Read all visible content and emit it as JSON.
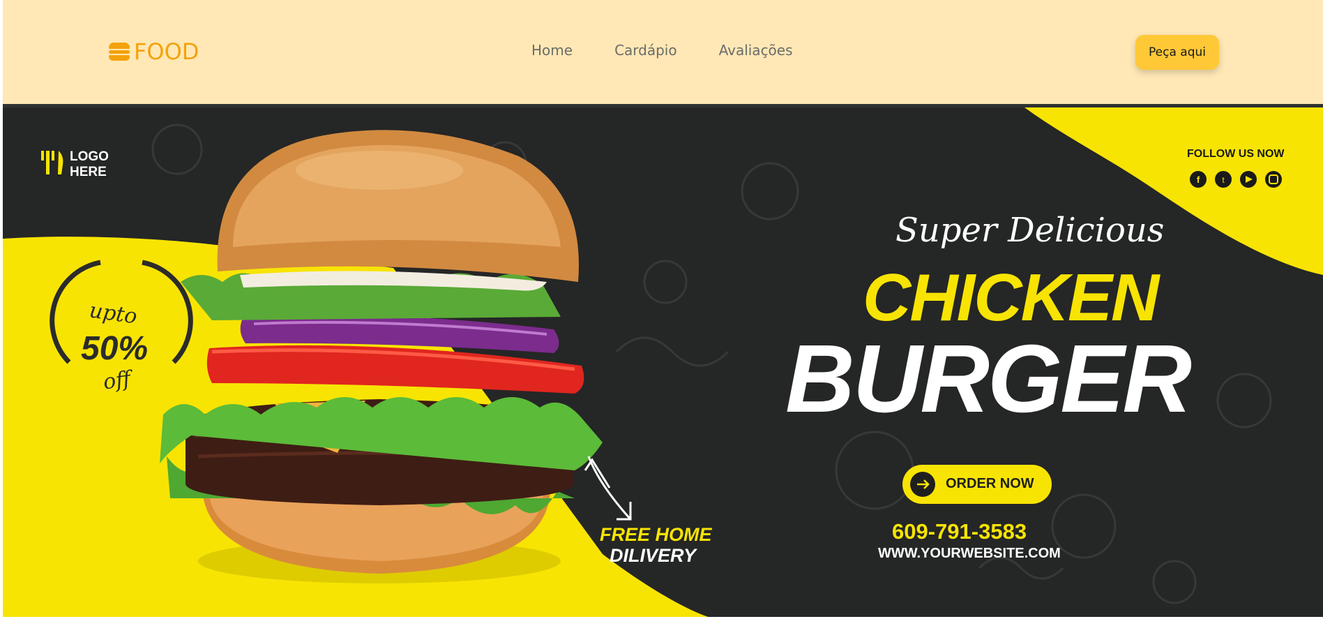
{
  "nav": {
    "brand": "FOOD",
    "links": [
      "Home",
      "Cardápio",
      "Avaliações"
    ],
    "cta": "Peça aqui"
  },
  "banner": {
    "logo_line1": "LOGO",
    "logo_line2": "HERE",
    "follow": "FOLLOW US NOW",
    "social_icons": [
      "facebook-icon",
      "twitter-icon",
      "youtube-icon",
      "instagram-icon"
    ],
    "promo_upto": "upto",
    "promo_percent": "50%",
    "promo_off": "off",
    "tagline": "Super Delicious",
    "headline1": "CHICKEN",
    "headline2": "BURGER",
    "order_label": "ORDER NOW",
    "free_delivery_1": "FREE HOME",
    "free_delivery_2": "DILIVERY",
    "phone": "609-791-3583",
    "website": "WWW.YOURWEBSITE.COM"
  },
  "colors": {
    "nav_bg": "#ffe8b5",
    "brand": "#f3a20d",
    "cta_bg": "#ffc837",
    "banner_dark": "#252626",
    "banner_yellow": "#f8e403"
  }
}
